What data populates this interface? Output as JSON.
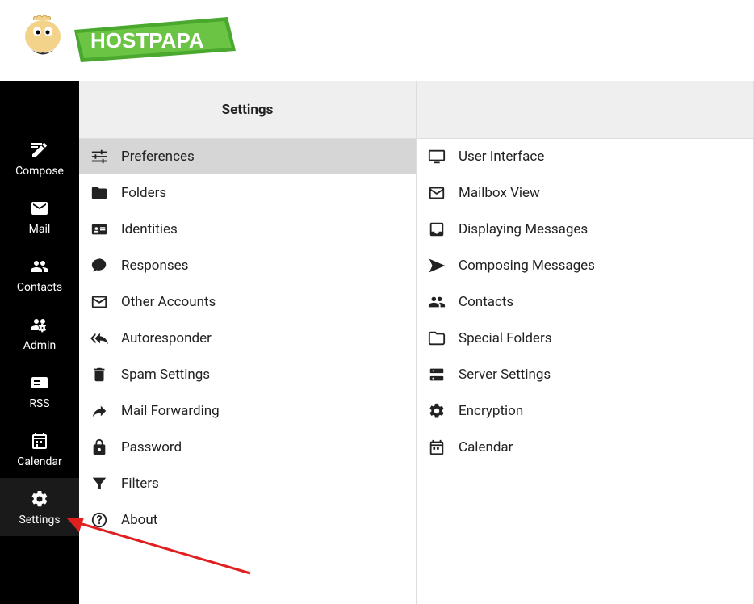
{
  "logo": {
    "text": "HOSTPAPA"
  },
  "nav": {
    "items": [
      {
        "key": "compose",
        "label": "Compose"
      },
      {
        "key": "mail",
        "label": "Mail"
      },
      {
        "key": "contacts",
        "label": "Contacts"
      },
      {
        "key": "admin",
        "label": "Admin"
      },
      {
        "key": "rss",
        "label": "RSS"
      },
      {
        "key": "calendar",
        "label": "Calendar"
      },
      {
        "key": "settings",
        "label": "Settings"
      }
    ]
  },
  "settings_col": {
    "header": "Settings",
    "items": [
      {
        "key": "preferences",
        "label": "Preferences",
        "selected": true
      },
      {
        "key": "folders",
        "label": "Folders"
      },
      {
        "key": "identities",
        "label": "Identities"
      },
      {
        "key": "responses",
        "label": "Responses"
      },
      {
        "key": "other-accounts",
        "label": "Other Accounts"
      },
      {
        "key": "autoresponder",
        "label": "Autoresponder"
      },
      {
        "key": "spam-settings",
        "label": "Spam Settings"
      },
      {
        "key": "mail-forwarding",
        "label": "Mail Forwarding"
      },
      {
        "key": "password",
        "label": "Password"
      },
      {
        "key": "filters",
        "label": "Filters"
      },
      {
        "key": "about",
        "label": "About"
      }
    ]
  },
  "prefs_col": {
    "header": "",
    "items": [
      {
        "key": "user-interface",
        "label": "User Interface"
      },
      {
        "key": "mailbox-view",
        "label": "Mailbox View"
      },
      {
        "key": "displaying-messages",
        "label": "Displaying Messages"
      },
      {
        "key": "composing-messages",
        "label": "Composing Messages"
      },
      {
        "key": "contacts",
        "label": "Contacts"
      },
      {
        "key": "special-folders",
        "label": "Special Folders"
      },
      {
        "key": "server-settings",
        "label": "Server Settings"
      },
      {
        "key": "encryption",
        "label": "Encryption"
      },
      {
        "key": "calendar",
        "label": "Calendar"
      }
    ]
  }
}
